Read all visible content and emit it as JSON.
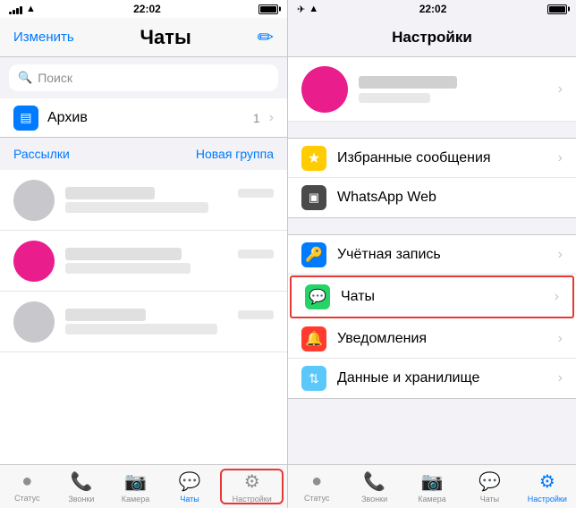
{
  "left": {
    "status_bar": {
      "time": "22:02"
    },
    "nav": {
      "edit": "Изменить",
      "title": "Чаты",
      "compose": "✏"
    },
    "search_placeholder": "Поиск",
    "archive": {
      "label": "Архив",
      "count": "1",
      "chevron": "›"
    },
    "bulk_actions": {
      "broadcasts": "Рассылки",
      "new_group": "Новая группа"
    },
    "tabs": [
      {
        "id": "status",
        "label": "Статус",
        "icon": "○"
      },
      {
        "id": "calls",
        "label": "Звонки",
        "icon": "☎"
      },
      {
        "id": "camera",
        "label": "Камера",
        "icon": "⊙"
      },
      {
        "id": "chats",
        "label": "Чаты",
        "icon": "💬",
        "active": true
      },
      {
        "id": "settings",
        "label": "Настройки",
        "icon": "⚙"
      }
    ]
  },
  "right": {
    "status_bar": {
      "time": "22:02"
    },
    "nav": {
      "title": "Настройки"
    },
    "settings_items": [
      {
        "id": "starred",
        "icon": "★",
        "icon_color": "icon-yellow",
        "label": "Избранные сообщения",
        "has_chevron": true
      },
      {
        "id": "whatsapp_web",
        "icon": "▣",
        "icon_color": "icon-dark",
        "label": "WhatsApp Web",
        "has_chevron": false
      }
    ],
    "settings_items2": [
      {
        "id": "account",
        "icon": "🔑",
        "icon_color": "icon-blue",
        "label": "Учётная запись",
        "has_chevron": true
      },
      {
        "id": "chats",
        "icon": "💬",
        "icon_color": "icon-green",
        "label": "Чаты",
        "has_chevron": true,
        "highlighted": true
      },
      {
        "id": "notifications",
        "icon": "🔔",
        "icon_color": "icon-red",
        "label": "Уведомления",
        "has_chevron": true
      },
      {
        "id": "data",
        "icon": "⇅",
        "icon_color": "icon-teal",
        "label": "Данные и хранилище",
        "has_chevron": true
      }
    ],
    "tabs": [
      {
        "id": "status",
        "label": "Статус",
        "icon": "○"
      },
      {
        "id": "calls",
        "label": "Звонки",
        "icon": "☎"
      },
      {
        "id": "camera",
        "label": "Камера",
        "icon": "⊙"
      },
      {
        "id": "chats",
        "label": "Чаты",
        "icon": "💬"
      },
      {
        "id": "settings",
        "label": "Настройки",
        "icon": "⚙",
        "active": true
      }
    ]
  }
}
